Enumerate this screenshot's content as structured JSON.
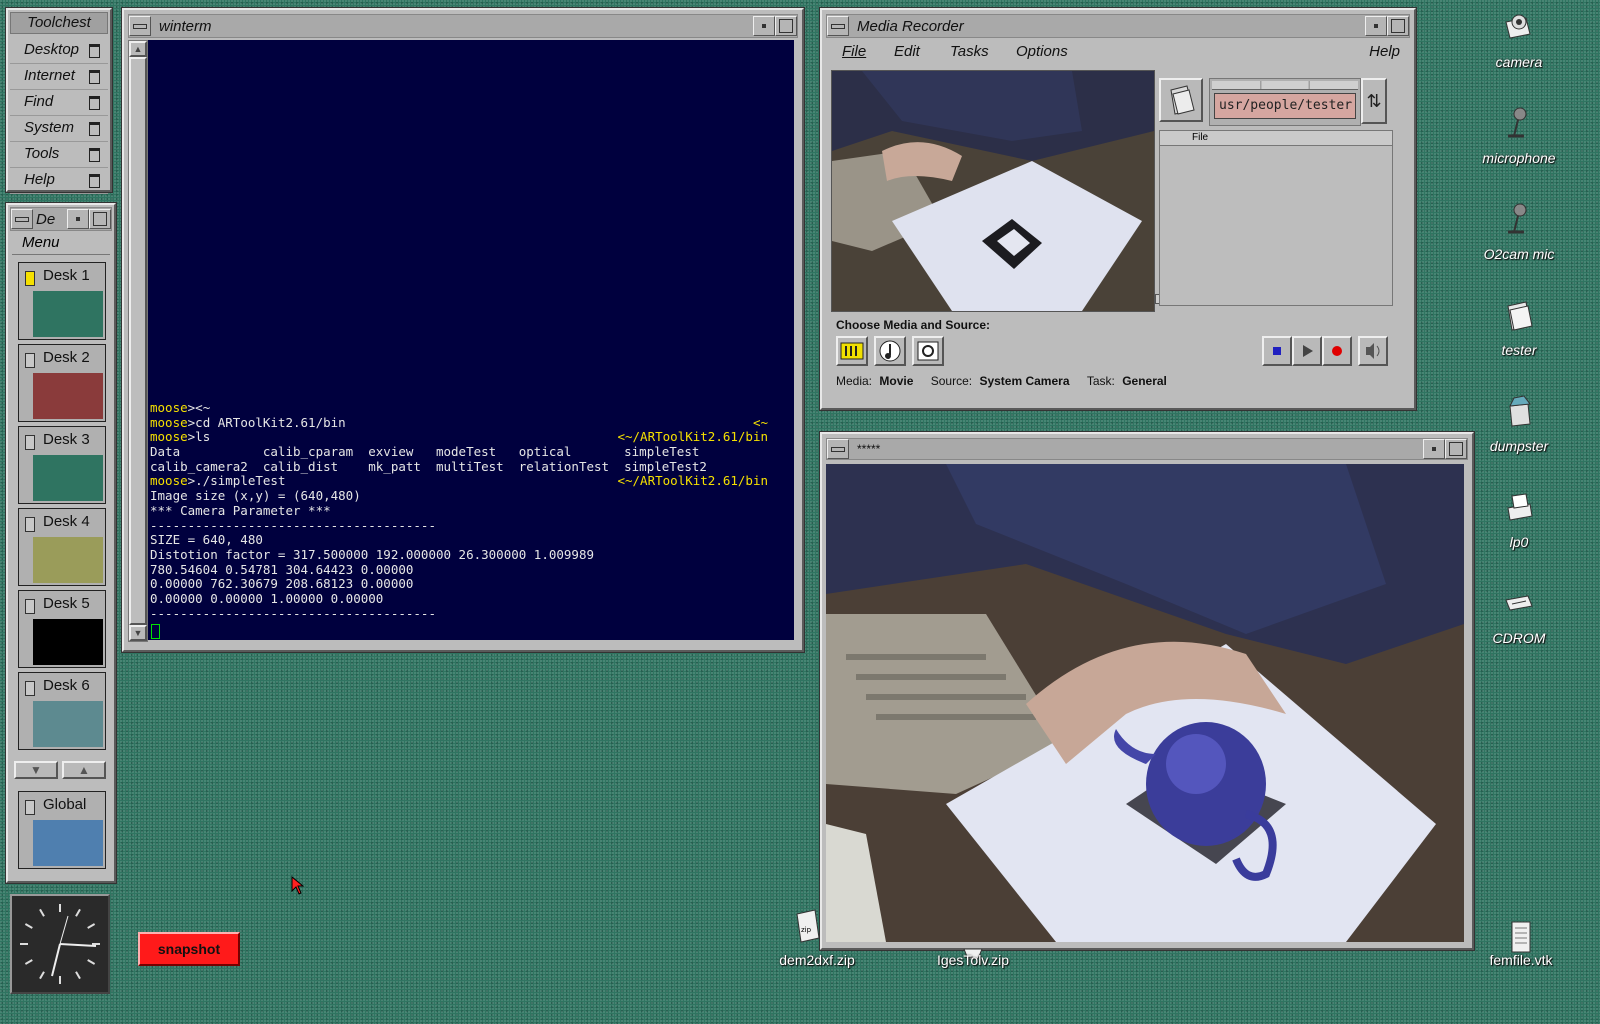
{
  "toolchest": {
    "title": "Toolchest",
    "items": [
      "Desktop",
      "Internet",
      "Find",
      "System",
      "Tools",
      "Help"
    ]
  },
  "desks_panel": {
    "title": "De",
    "menu": "Menu",
    "desks": [
      {
        "label": "Desk 1",
        "color": "#2f7461"
      },
      {
        "label": "Desk 2",
        "color": "#8a3b3b"
      },
      {
        "label": "Desk 3",
        "color": "#2f7461"
      },
      {
        "label": "Desk 4",
        "color": "#9a9c5a"
      },
      {
        "label": "Desk 5",
        "color": "#000000"
      },
      {
        "label": "Desk 6",
        "color": "#5d8a90"
      }
    ],
    "global": {
      "label": "Global",
      "color": "#4f7faf"
    }
  },
  "winterm": {
    "title": "winterm",
    "lines": [
      {
        "prompt": "moose",
        "text": "><~",
        "right": ""
      },
      {
        "prompt": "moose",
        "text": ">cd ARToolKit2.61/bin",
        "right": "<~"
      },
      {
        "prompt": "moose",
        "text": ">ls",
        "right": "<~/ARToolKit2.61/bin"
      },
      {
        "prompt": "",
        "text": "Data           calib_cparam  exview   modeTest   optical       simpleTest",
        "right": ""
      },
      {
        "prompt": "",
        "text": "calib_camera2  calib_dist    mk_patt  multiTest  relationTest  simpleTest2",
        "right": ""
      },
      {
        "prompt": "moose",
        "text": ">./simpleTest",
        "right": "<~/ARToolKit2.61/bin"
      },
      {
        "prompt": "",
        "text": "Image size (x,y) = (640,480)",
        "right": ""
      },
      {
        "prompt": "",
        "text": "*** Camera Parameter ***",
        "right": ""
      },
      {
        "prompt": "",
        "text": "--------------------------------------",
        "right": ""
      },
      {
        "prompt": "",
        "text": "SIZE = 640, 480",
        "right": ""
      },
      {
        "prompt": "",
        "text": "Distotion factor = 317.500000 192.000000 26.300000 1.009989",
        "right": ""
      },
      {
        "prompt": "",
        "text": "780.54604 0.54781 304.64423 0.00000",
        "right": ""
      },
      {
        "prompt": "",
        "text": "0.00000 762.30679 208.68123 0.00000",
        "right": ""
      },
      {
        "prompt": "",
        "text": "0.00000 0.00000 1.00000 0.00000",
        "right": ""
      },
      {
        "prompt": "",
        "text": "--------------------------------------",
        "right": ""
      }
    ]
  },
  "media_recorder": {
    "title": "Media Recorder",
    "menus": [
      "File",
      "Edit",
      "Tasks",
      "Options"
    ],
    "help": "Help",
    "path": "usr/people/tester",
    "file_column": "File",
    "choose_label": "Choose Media and Source:",
    "media_label": "Media:",
    "media_value": "Movie",
    "source_label": "Source:",
    "source_value": "System Camera",
    "task_label": "Task:",
    "task_value": "General"
  },
  "video_window": {
    "title": "*****"
  },
  "desktop_icons": [
    {
      "label": "camera",
      "icon": "camera-icon"
    },
    {
      "label": "microphone",
      "icon": "microphone-icon"
    },
    {
      "label": "O2cam mic",
      "icon": "microphone-icon"
    },
    {
      "label": "tester",
      "icon": "folder-icon"
    },
    {
      "label": "dumpster",
      "icon": "trash-icon"
    },
    {
      "label": "lp0",
      "icon": "printer-icon"
    },
    {
      "label": "CDROM",
      "icon": "cdrom-icon"
    }
  ],
  "files": [
    {
      "label": "dem2dxf.zip"
    },
    {
      "label": "IgesTolv.zip"
    },
    {
      "label": "femfile.vtk"
    }
  ],
  "snapshot_button": "snapshot"
}
